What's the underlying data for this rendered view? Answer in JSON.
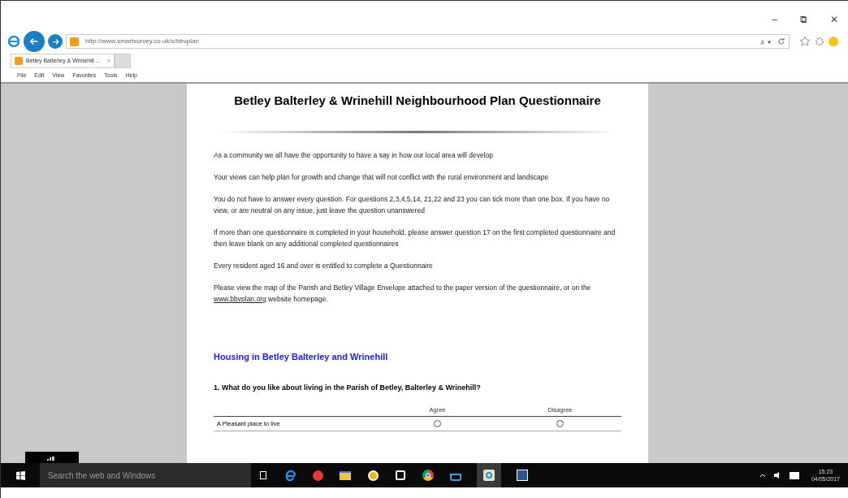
{
  "browser": {
    "address": "http://www.smartsurvey.co.uk/s/bbvplan",
    "tab_title": "Betley Balterley & Wrinehill ...",
    "menu": [
      "File",
      "Edit",
      "View",
      "Favorites",
      "Tools",
      "Help"
    ],
    "search_glyph": "⌕ ▾",
    "tab_close": "×",
    "window_controls": [
      "–",
      "⧉",
      "✕"
    ]
  },
  "page": {
    "title": "Betley Balterley & Wrinehill Neighbourhood Plan Questionnaire",
    "paragraphs": [
      {
        "text": "As a community we all have the opportunity to have a say in how our local area will develop"
      },
      {
        "text": "Your views can help plan for growth and change that will not conflict with the rural environment and landscape"
      },
      {
        "text": "You do not have to answer every question. For questions 2,3,4,5,14, 21,22 and 23 you can tick more than one box. If you have no view, or are neutral on any issue, just leave the question unanswered"
      },
      {
        "text": "If more than one questionnaire is completed in your household, please answer question 17 on the first completed questionnaire and then leave blank on any additional completed questionnaires"
      },
      {
        "text": "Every resident aged 16 and over is entitled to complete a Questionnaire"
      },
      {
        "text": "Please view the map of the Parish and Betley Village Envelope attached to the paper version of the questionnaire, or on the",
        "link": "www.bbvplan.org",
        "after": "website homepage."
      }
    ],
    "section_heading": "Housing in Betley Balterley and Wrinehill",
    "question": "1. What do you like about living in the Parish of Betley, Balterley & Wrinehill?",
    "columns": [
      "Agree",
      "Disagree"
    ],
    "rows": [
      {
        "label": "A Pleasant place to live",
        "choices": [
          {
            "selected": false
          },
          {
            "selected": false
          }
        ]
      }
    ]
  },
  "taskbar": {
    "search_placeholder": "Search the web and Windows",
    "time": "15:23",
    "date": "04/05/2017"
  }
}
